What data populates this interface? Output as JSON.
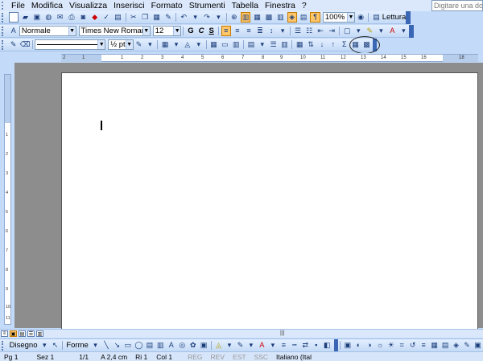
{
  "menu": {
    "items": [
      {
        "label": "File"
      },
      {
        "label": "Modifica"
      },
      {
        "label": "Visualizza"
      },
      {
        "label": "Inserisci"
      },
      {
        "label": "Formato"
      },
      {
        "label": "Strumenti"
      },
      {
        "label": "Tabella"
      },
      {
        "label": "Finestra"
      },
      {
        "label": "?"
      }
    ],
    "help_placeholder": "Digitare una dom"
  },
  "standard_toolbar": {
    "zoom": "100%",
    "reading_button": "Lettura"
  },
  "formatting_toolbar": {
    "style": "Normale",
    "font": "Times New Roman",
    "size": "12",
    "bold": "G",
    "italic": "C",
    "underline": "S"
  },
  "tables_toolbar": {
    "line_weight": "½ pt"
  },
  "ruler": {
    "numbers": [
      "2",
      "1",
      "1",
      "2",
      "3",
      "4",
      "5",
      "6",
      "7",
      "8",
      "9",
      "10",
      "11",
      "12",
      "13",
      "14",
      "15",
      "16",
      "18"
    ]
  },
  "vertical_ruler": {
    "numbers": [
      "1",
      "2",
      "3",
      "4",
      "5",
      "6",
      "7",
      "8",
      "9",
      "10",
      "11"
    ]
  },
  "drawing_toolbar": {
    "draw_label": "Disegno",
    "shapes_label": "Forme"
  },
  "status": {
    "page": "Pg 1",
    "section": "Sez 1",
    "pages": "1/1",
    "at": "A 2,4 cm",
    "line": "Ri 1",
    "col": "Col 1",
    "rec": "REG",
    "rev": "REV",
    "ext": "EST",
    "ovr": "SSC",
    "language": "Italiano (Ital"
  }
}
